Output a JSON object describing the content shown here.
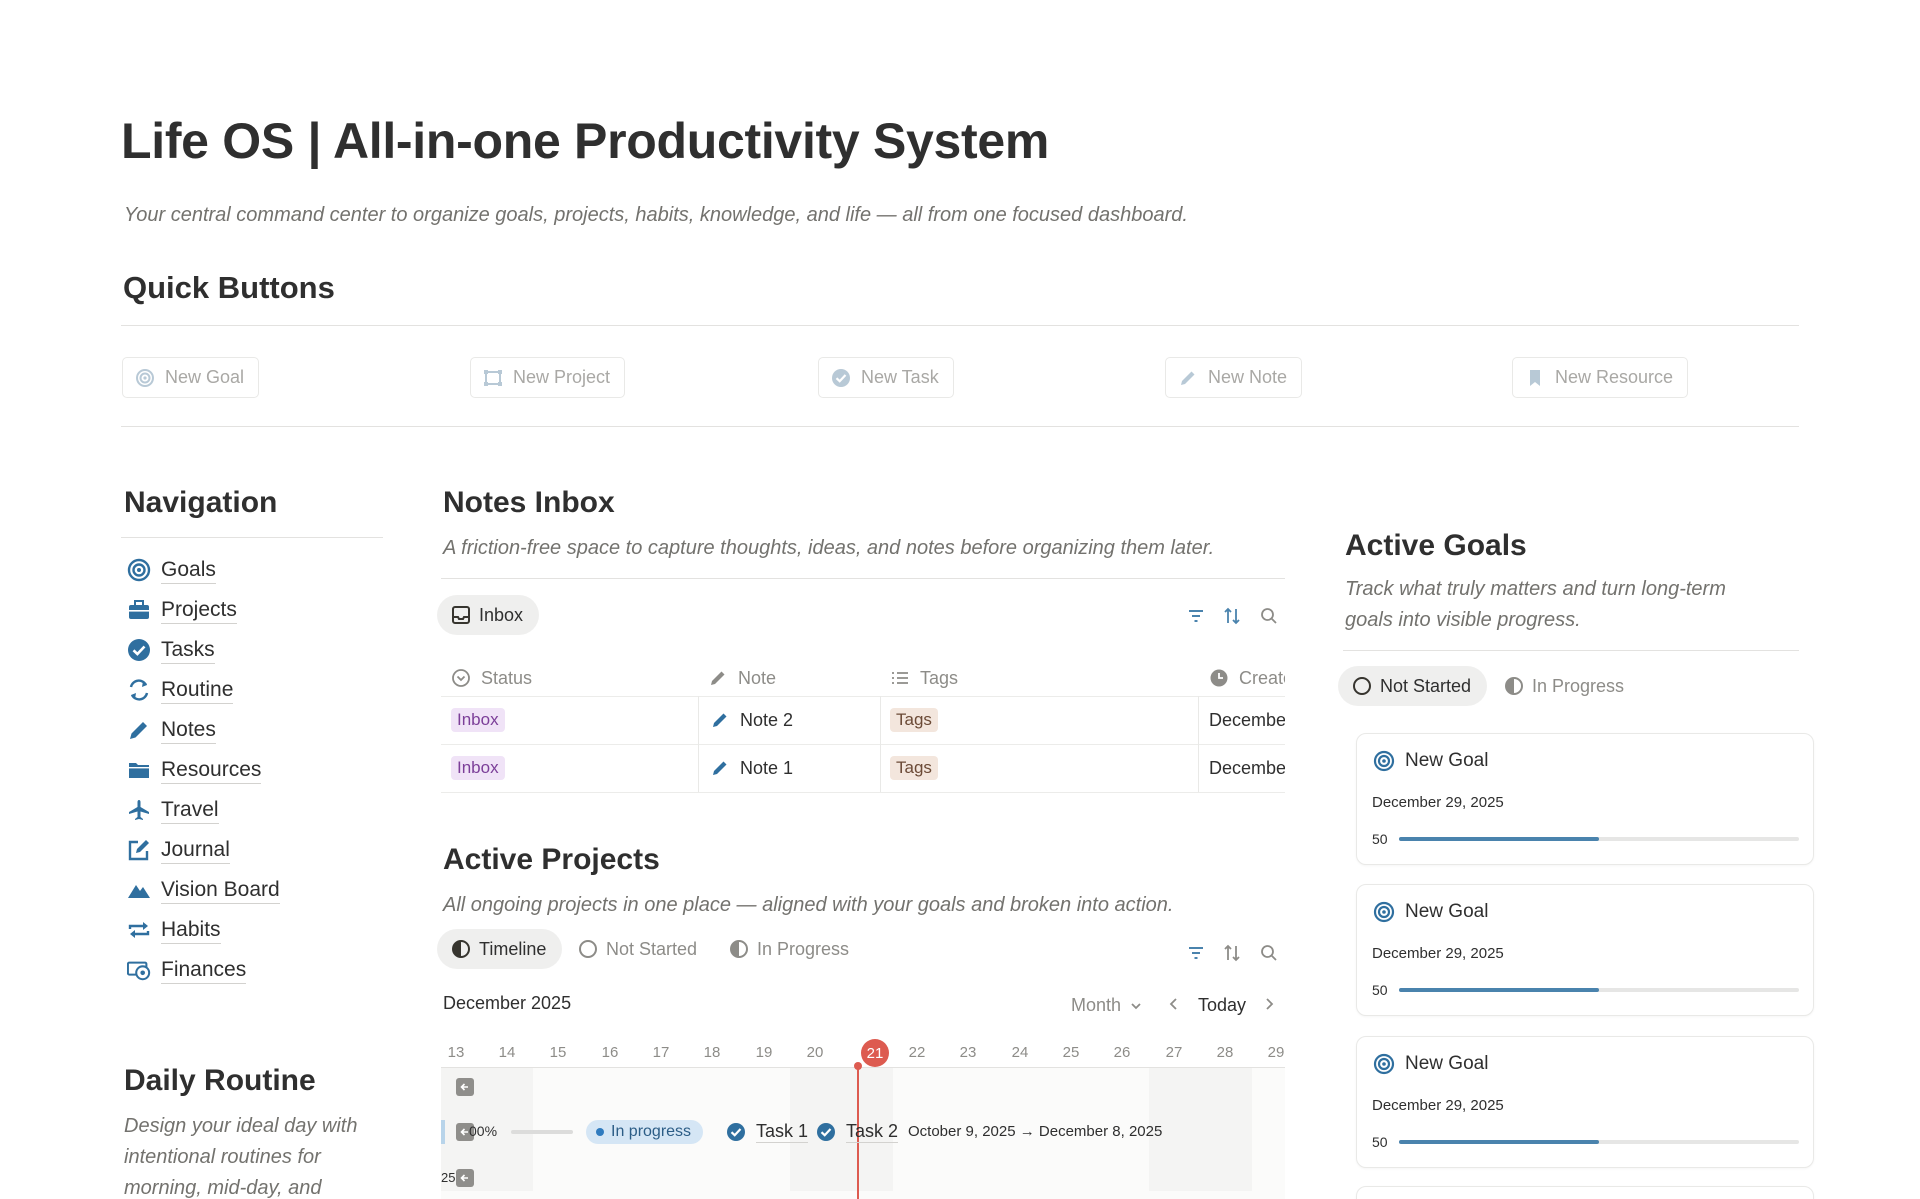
{
  "page": {
    "title": "Life OS | All-in-one Productivity System",
    "subtitle": "Your central command center to organize goals, projects, habits, knowledge, and life — all from one focused dashboard."
  },
  "colors": {
    "accent": "#2f6f9f",
    "today": "#dd5b50",
    "progress": "#4a83ad"
  },
  "quick_buttons": {
    "heading": "Quick Buttons",
    "items": [
      {
        "label": "New Goal",
        "icon": "target-icon"
      },
      {
        "label": "New Project",
        "icon": "frame-icon"
      },
      {
        "label": "New Task",
        "icon": "check-circle-icon"
      },
      {
        "label": "New Note",
        "icon": "pencil-icon"
      },
      {
        "label": "New Resource",
        "icon": "bookmark-icon"
      }
    ]
  },
  "navigation": {
    "heading": "Navigation",
    "items": [
      {
        "label": "Goals",
        "icon": "target-icon"
      },
      {
        "label": "Projects",
        "icon": "briefcase-icon"
      },
      {
        "label": "Tasks",
        "icon": "check-circle-icon"
      },
      {
        "label": "Routine",
        "icon": "repeat-icon"
      },
      {
        "label": "Notes",
        "icon": "pencil-icon"
      },
      {
        "label": "Resources",
        "icon": "folder-icon"
      },
      {
        "label": "Travel",
        "icon": "airplane-icon"
      },
      {
        "label": "Journal",
        "icon": "edit-square-icon"
      },
      {
        "label": "Vision Board",
        "icon": "mountain-icon"
      },
      {
        "label": "Habits",
        "icon": "arrows-cycle-icon"
      },
      {
        "label": "Finances",
        "icon": "money-icon"
      }
    ]
  },
  "daily_routine": {
    "heading": "Daily Routine",
    "desc_lines": [
      "Design your ideal day with",
      "intentional routines for",
      "morning, mid-day, and"
    ]
  },
  "notes_inbox": {
    "heading": "Notes Inbox",
    "desc": "A friction-free space to capture thoughts, ideas, and notes before organizing them later.",
    "view_tab": "Inbox",
    "columns": [
      "Status",
      "Note",
      "Tags",
      "Create"
    ],
    "rows": [
      {
        "status": "Inbox",
        "note": "Note 2",
        "tags": "Tags",
        "created": "December"
      },
      {
        "status": "Inbox",
        "note": "Note 1",
        "tags": "Tags",
        "created": "December"
      }
    ]
  },
  "active_projects": {
    "heading": "Active Projects",
    "desc": "All ongoing projects in one place — aligned with your goals and broken into action.",
    "tabs": [
      "Timeline",
      "Not Started",
      "In Progress"
    ],
    "timeline": {
      "month": "December 2025",
      "scale": "Month",
      "today_label": "Today",
      "days": [
        "13",
        "14",
        "15",
        "16",
        "17",
        "18",
        "19",
        "20",
        "21",
        "22",
        "23",
        "24",
        "25",
        "26",
        "27",
        "28",
        "29"
      ],
      "today_day": "21",
      "row": {
        "progress_text": "00%",
        "status": "In progress",
        "tasks": [
          "Task 1",
          "Task 2"
        ],
        "dates": "October 9, 2025 → December 8, 2025"
      },
      "row3_stub": "25"
    }
  },
  "active_goals": {
    "heading": "Active Goals",
    "desc_lines": [
      "Track what truly matters and turn long-term",
      "goals into visible progress."
    ],
    "tabs": [
      "Not Started",
      "In Progress"
    ],
    "cards": [
      {
        "title": "New Goal",
        "date": "December 29, 2025",
        "value": "50",
        "progress": 0.5
      },
      {
        "title": "New Goal",
        "date": "December 29, 2025",
        "value": "50",
        "progress": 0.5
      },
      {
        "title": "New Goal",
        "date": "December 29, 2025",
        "value": "50",
        "progress": 0.5
      }
    ]
  }
}
